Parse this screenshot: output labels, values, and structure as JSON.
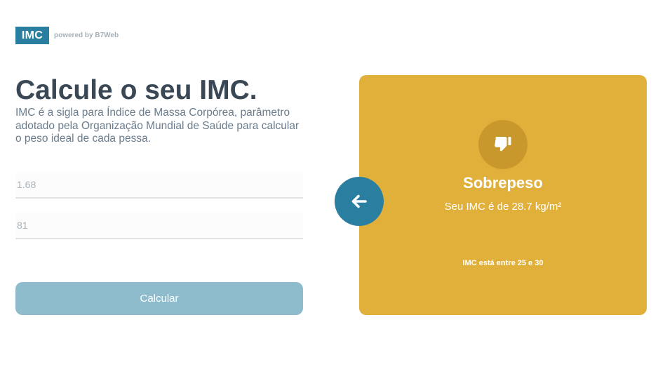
{
  "header": {
    "logo_text": "IMC",
    "powered_by": "powered by B7Web"
  },
  "main": {
    "title": "Calcule o seu IMC.",
    "description": "IMC é a sigla para Índice de Massa Corpórea, parâmetro adotado pela Organização Mundial de Saúde para calcular o peso ideal de cada pessa."
  },
  "form": {
    "height_value": "1.68",
    "weight_value": "81",
    "calculate_label": "Calcular"
  },
  "result": {
    "icon": "thumbs-down-icon",
    "title": "Sobrepeso",
    "value_text": "Seu IMC é de 28.7 kg/m²",
    "range_prefix": "IMC está entre ",
    "range_min": "25",
    "range_mid": " e ",
    "range_max": "30",
    "back_icon": "arrow-left-icon"
  },
  "colors": {
    "brand": "#2a7fa0",
    "panel": "#e1b03a",
    "icon_circle": "#c9982d",
    "button_disabled": "#8fbccd",
    "title": "#3a4856"
  }
}
